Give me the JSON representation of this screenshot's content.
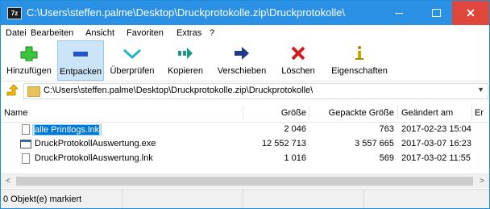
{
  "window": {
    "title": "C:\\Users\\steffen.palme\\Desktop\\Druckprotokolle.zip\\Druckprotokolle\\",
    "app_icon_text": "7z",
    "accent": "#2b91e4",
    "close_color": "#e0473a"
  },
  "menu": {
    "items": [
      "Datei",
      "Bearbeiten",
      "Ansicht",
      "Favoriten",
      "Extras",
      "?"
    ]
  },
  "toolbar": {
    "add_label": "Hinzufügen",
    "extract_label": "Entpacken",
    "test_label": "Überprüfen",
    "copy_label": "Kopieren",
    "move_label": "Verschieben",
    "delete_label": "Löschen",
    "info_label": "Eigenschaften"
  },
  "address": {
    "path": "C:\\Users\\steffen.palme\\Desktop\\Druckprotokolle.zip\\Druckprotokolle\\"
  },
  "table": {
    "columns": [
      "Name",
      "Größe",
      "Gepackte Größe",
      "Geändert am",
      "Er"
    ],
    "rows": [
      {
        "name": "alle Printlogs.lnk",
        "size": "2 046",
        "packed": "763",
        "modified": "2017-02-23 15:04",
        "icon": "file-icon",
        "selected": true
      },
      {
        "name": "DruckProtokollAuswertung.exe",
        "size": "12 552 713",
        "packed": "3 557 665",
        "modified": "2017-03-07 16:23",
        "icon": "exe-icon",
        "selected": false
      },
      {
        "name": "DruckProtokollAuswertung.lnk",
        "size": "1 016",
        "packed": "569",
        "modified": "2017-03-02 11:55",
        "icon": "file-icon",
        "selected": false
      }
    ]
  },
  "status": {
    "text": "0 Objekt(e) markiert"
  }
}
